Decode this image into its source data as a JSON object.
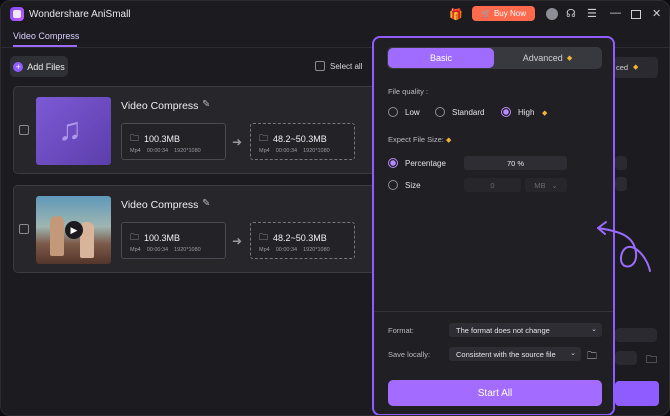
{
  "app": {
    "title": "Wondershare AniSmall",
    "buy_label": "Buy Now"
  },
  "titlebar_icons": {
    "gift": "gift-icon",
    "cart": "cart-icon",
    "avatar": "avatar-icon",
    "headset": "headset-icon",
    "menu": "menu-icon",
    "minimize": "minimize-icon",
    "maximize": "maximize-icon",
    "close": "close-icon"
  },
  "tabs": {
    "main": "Video Compress"
  },
  "toolbar": {
    "add_files": "Add Files",
    "select_all": "Select all"
  },
  "files": [
    {
      "title": "Video Compress",
      "src_size": "100.3MB",
      "src_meta": [
        "Mp4",
        "00:00:34",
        "1920*1080"
      ],
      "dst_size": "48.2~50.3MB",
      "dst_meta": [
        "Mp4",
        "00:00:34",
        "1920*1080"
      ]
    },
    {
      "title": "Video Compress",
      "src_size": "100.3MB",
      "src_meta": [
        "Mp4",
        "00:00:34",
        "1920*1080"
      ],
      "dst_size": "48.2~50.3MB",
      "dst_meta": [
        "Mp4",
        "00:00:34",
        "1920*1080"
      ]
    }
  ],
  "background": {
    "partial_label": "ced"
  },
  "panel": {
    "tab_basic": "Basic",
    "tab_advanced": "Advanced",
    "quality_label": "File quality :",
    "quality_options": [
      "Low",
      "Standard",
      "High"
    ],
    "quality_selected": "High",
    "expect_label": "Expect File Size:",
    "percentage_label": "Percentage",
    "percentage_value": "70 %",
    "size_label": "Size",
    "size_value": "0",
    "size_unit": "MB",
    "format_label": "Format:",
    "format_value": "The format does not change",
    "save_label": "Save locally:",
    "save_value": "Consistent with the source file",
    "start_label": "Start All"
  },
  "colors": {
    "accent": "#a36bff",
    "buy": "#ff6a4d",
    "premium": "#f2b234"
  }
}
